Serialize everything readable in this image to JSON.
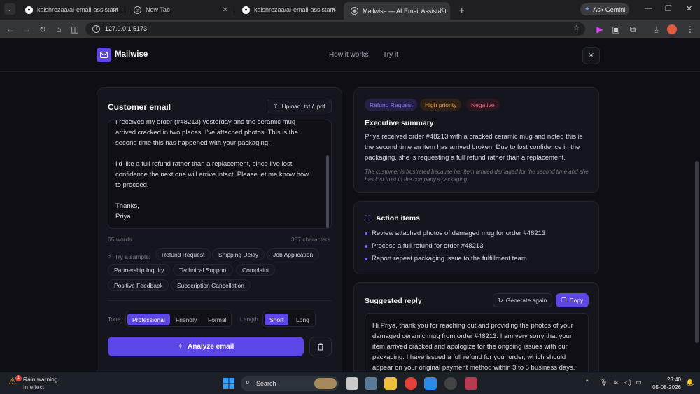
{
  "browser": {
    "tabs": [
      {
        "title": "kaishrezaa/ai-email-assistant",
        "icon": "github-icon"
      },
      {
        "title": "New Tab",
        "icon": "chrome-icon"
      },
      {
        "title": "kaishrezaa/ai-email-assistant",
        "icon": "github-icon"
      },
      {
        "title": "Mailwise — AI Email Assistant",
        "icon": "globe-icon",
        "active": true
      }
    ],
    "new_tab_symbol": "+",
    "url": "127.0.0.1:5173",
    "gemini_label": "Ask Gemini"
  },
  "app": {
    "brand": "Mailwise",
    "nav": [
      "How it works",
      "Try it"
    ],
    "accent": "#5b46e6"
  },
  "input_panel": {
    "title": "Customer email",
    "upload_label": "Upload .txt / .pdf",
    "email_lines": "I received my order (#48213) yesterday and the ceramic mug\narrived cracked in two places. I've attached photos. This is the\nsecond time this has happened with your packaging.\n\nI'd like a full refund rather than a replacement, since I've lost\nconfidence the next one will arrive intact. Please let me know how\nto proceed.\n\nThanks,\nPriya",
    "word_count": "65 words",
    "char_count": "387 characters",
    "sample_label": "Try a sample:",
    "samples": [
      "Refund Request",
      "Shipping Delay",
      "Job Application",
      "Partnership Inquiry",
      "Technical Support",
      "Complaint",
      "Positive Feedback",
      "Subscription Cancellation"
    ],
    "tone_label": "Tone",
    "tones": [
      "Professional",
      "Friendly",
      "Formal"
    ],
    "tone_selected": "Professional",
    "length_label": "Length",
    "lengths": [
      "Short",
      "Long"
    ],
    "length_selected": "Short",
    "analyze_label": "Analyze email"
  },
  "summary": {
    "badges": [
      {
        "label": "Refund Request",
        "color": "#8b7bff"
      },
      {
        "label": "High priority",
        "color": "#f0a24a"
      },
      {
        "label": "Negative",
        "color": "#f06a8a"
      }
    ],
    "title": "Executive summary",
    "body": "Priya received order #48213 with a cracked ceramic mug and noted this is the second time an item has arrived broken. Due to lost confidence in the packaging, she is requesting a full refund rather than a replacement.",
    "note": "The customer is frustrated because her item arrived damaged for the second time and she has lost trust in the company's packaging."
  },
  "actions": {
    "title": "Action items",
    "items": [
      "Review attached photos of damaged mug for order #48213",
      "Process a full refund for order #48213",
      "Report repeat packaging issue to the fulfillment team"
    ]
  },
  "reply": {
    "title": "Suggested reply",
    "regenerate_label": "Generate again",
    "copy_label": "Copy",
    "text": "Hi Priya, thank you for reaching out and providing the photos of your damaged ceramic mug from order #48213. I am very sorry that your item arrived cracked and apologize for the ongoing issues with our packaging. I have issued a full refund for your order, which should appear on your original payment method within 3 to 5 business days."
  },
  "taskbar": {
    "weather_title": "Rain warning",
    "weather_sub": "In effect",
    "weather_badge": "1",
    "search_label": "Search",
    "time": "23:40",
    "date": "05-08-2026"
  }
}
